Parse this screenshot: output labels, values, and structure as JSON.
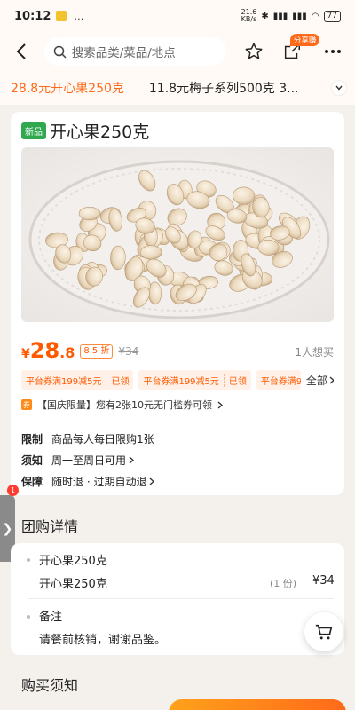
{
  "status_bar": {
    "time": "10:12",
    "extra": "…",
    "network_speed_value": "21.6",
    "network_speed_unit": "KB/s",
    "battery": "77"
  },
  "nav": {
    "search_placeholder": "搜索品类/菜品/地点",
    "share_badge": "分享赚"
  },
  "tabs": [
    {
      "label": "28.8元开心果250克",
      "active": true
    },
    {
      "label": "11.8元梅子系列500克 3...",
      "active": false
    }
  ],
  "product": {
    "badge": "新品",
    "title": "开心果250克",
    "price_symbol": "¥",
    "price_int": "28",
    "price_dec": ".8",
    "discount": "8.5 折",
    "original_price": "¥34",
    "want_count": "1人想买",
    "coupons": [
      {
        "text": "平台券满199减5元",
        "state": "已领"
      },
      {
        "text": "平台券满199减5元",
        "state": "已领"
      },
      {
        "text": "平台券满9",
        "state": ""
      }
    ],
    "all_label": "全部",
    "promo_icon": "券",
    "promo_text": "【国庆限量】您有2张10元无门槛券可领",
    "info": [
      {
        "label": "限制",
        "value": "商品每人每日限购1张",
        "has_arrow": false
      },
      {
        "label": "须知",
        "value": "周一至周日可用",
        "has_arrow": true
      },
      {
        "label": "保障",
        "value": "随时退 · 过期自动退",
        "has_arrow": true
      }
    ]
  },
  "side_handle": {
    "badge": "1",
    "arrow": "❯"
  },
  "group_details": {
    "title": "团购详情",
    "group_name": "开心果250克",
    "item_name": "开心果250克",
    "item_qty": "(1 份)",
    "item_price": "¥34",
    "note_title": "备注",
    "note_text": "请餐前核销，谢谢品鉴。"
  },
  "purchase_notes": {
    "title": "购买须知"
  },
  "colors": {
    "accent": "#ff6a1a",
    "price": "#ff5a00",
    "new_badge": "#2fa84f"
  },
  "icons": [
    "back-arrow-icon",
    "search-icon",
    "star-icon",
    "share-icon",
    "more-icon",
    "chevron-down-icon",
    "chevron-right-icon",
    "cart-icon"
  ]
}
